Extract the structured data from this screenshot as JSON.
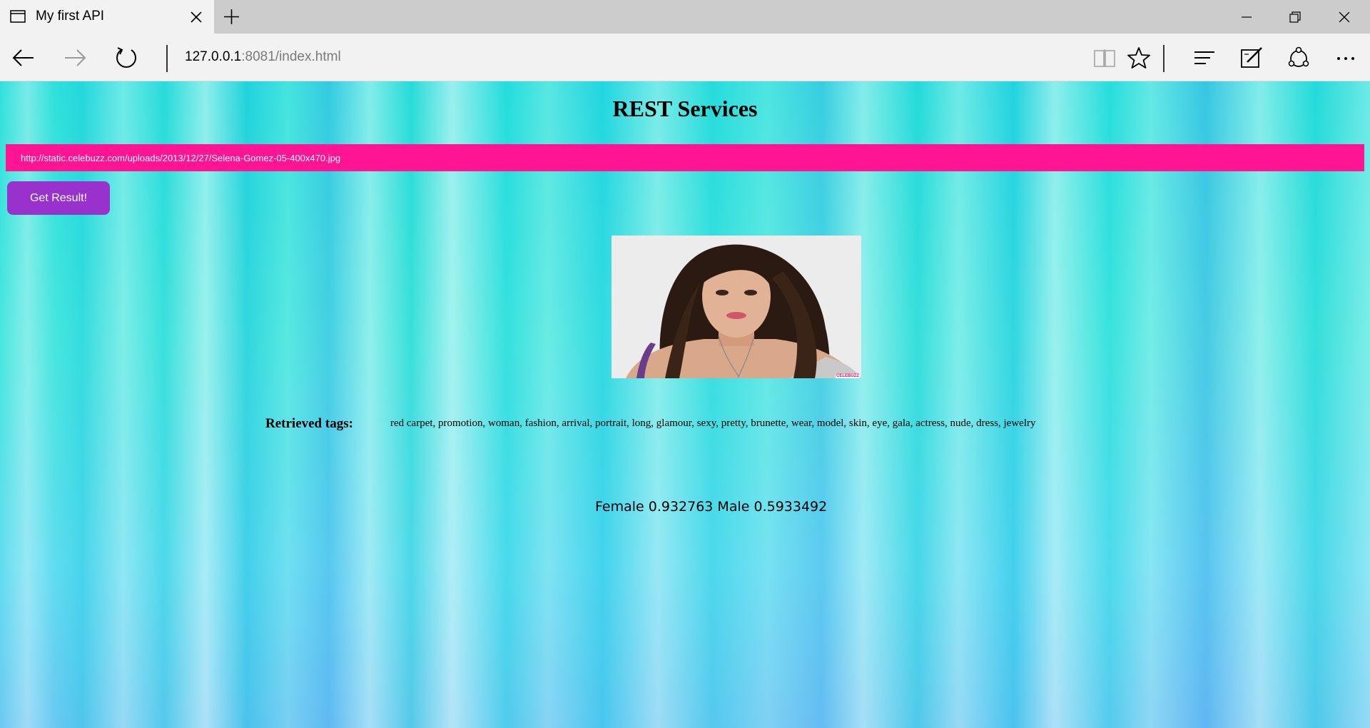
{
  "browser": {
    "tab": {
      "title": "My first API"
    },
    "address": {
      "host": "127.0.0.1",
      "rest": ":8081/index.html"
    }
  },
  "page": {
    "title": "REST Services",
    "image_url_input": {
      "value": "http://static.celebuzz.com/uploads/2013/12/27/Selena-Gomez-05-400x470.jpg"
    },
    "get_result_button": "Get Result!",
    "photo_watermark": "CELEBUZZ",
    "tags_label": "Retrieved tags:",
    "tags_value": "red carpet, promotion, woman, fashion, arrival, portrait, long, glamour, sexy, pretty, brunette, wear, model, skin, eye, gala, actress, nude, dress, jewelry",
    "gender_result": "Female 0.932763 Male 0.5933492"
  },
  "colors": {
    "input_bg": "#ff1493",
    "button_bg": "#9932cc",
    "page_bg": "#46e6de"
  },
  "icons": [
    "page-icon",
    "close-icon",
    "plus-icon",
    "minimize-icon",
    "restore-icon",
    "close-window-icon",
    "back-arrow-icon",
    "forward-arrow-icon",
    "refresh-icon",
    "reading-view-icon",
    "star-icon",
    "hub-icon",
    "web-note-icon",
    "share-icon",
    "more-icon"
  ]
}
